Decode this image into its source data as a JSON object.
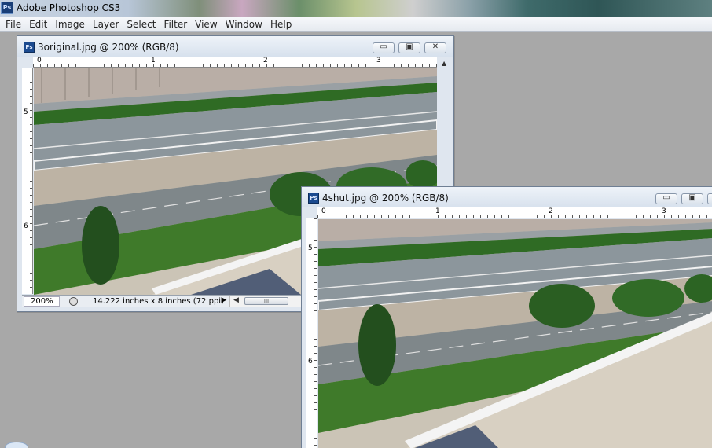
{
  "app": {
    "icon": "Ps",
    "title": "Adobe Photoshop CS3"
  },
  "menu": [
    "File",
    "Edit",
    "Image",
    "Layer",
    "Select",
    "Filter",
    "View",
    "Window",
    "Help"
  ],
  "windows": {
    "original": {
      "icon": "Ps",
      "title": "3original.jpg @ 200% (RGB/8)",
      "ruler_top": [
        "0",
        "1",
        "2",
        "3"
      ],
      "ruler_left": [
        "5",
        "6"
      ],
      "status": {
        "zoom": "200%",
        "doc_info": "14.222 inches x 8 inches (72 ppi)",
        "scroll_thumb": "III"
      }
    },
    "shut": {
      "icon": "Ps",
      "title": "4shut.jpg @ 200% (RGB/8)",
      "ruler_top": [
        "0",
        "1",
        "2",
        "3"
      ],
      "ruler_left": [
        "5",
        "6"
      ]
    }
  },
  "window_buttons": {
    "minimize": "▭",
    "restore": "▣",
    "close": "✕"
  },
  "colors": {
    "workspace": "#a8a8a8",
    "road": "#8c969c",
    "grass": "#3f7a2a",
    "hedge": "#2f6b24",
    "wall": "#c3b8a8"
  }
}
